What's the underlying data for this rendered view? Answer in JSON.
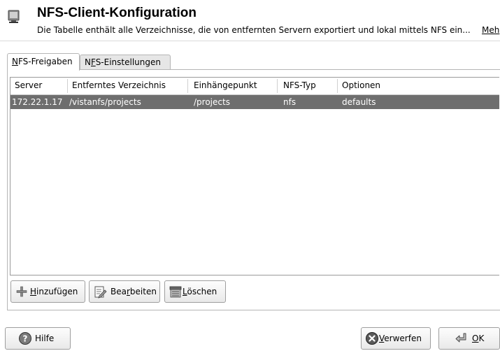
{
  "header": {
    "title": "NFS-Client-Konfiguration",
    "description": "Die Tabelle enthält alle Verzeichnisse, die von entfernten Servern exportiert und lokal mittels NFS ein...",
    "more_link": "Meh"
  },
  "tabs": [
    {
      "pre": "",
      "key": "N",
      "post": "FS-Freigaben"
    },
    {
      "pre": "N",
      "key": "F",
      "post": "S-Einstellungen"
    }
  ],
  "table": {
    "columns": [
      "Server",
      "Entferntes Verzeichnis",
      "Einhängepunkt",
      "NFS-Typ",
      "Optionen"
    ],
    "rows": [
      [
        "172.22.1.17",
        "/vistanfs/projects",
        "/projects",
        "nfs",
        "defaults"
      ]
    ]
  },
  "actions": {
    "add": {
      "pre": "",
      "key": "H",
      "post": "inzufügen"
    },
    "edit": {
      "pre": "Bea",
      "key": "r",
      "post": "beiten"
    },
    "delete": {
      "pre": "",
      "key": "L",
      "post": "öschen"
    }
  },
  "footer": {
    "help": "Hilfe",
    "discard": {
      "pre": "",
      "key": "V",
      "post": "erwerfen"
    },
    "ok": {
      "pre": "",
      "key": "O",
      "post": "K"
    }
  },
  "icons": {
    "header": "computer-monitor-icon",
    "add": "plus-icon",
    "edit": "edit-icon",
    "delete": "delete-icon",
    "help": "help-icon",
    "discard": "cancel-icon",
    "ok": "return-arrow-icon"
  }
}
